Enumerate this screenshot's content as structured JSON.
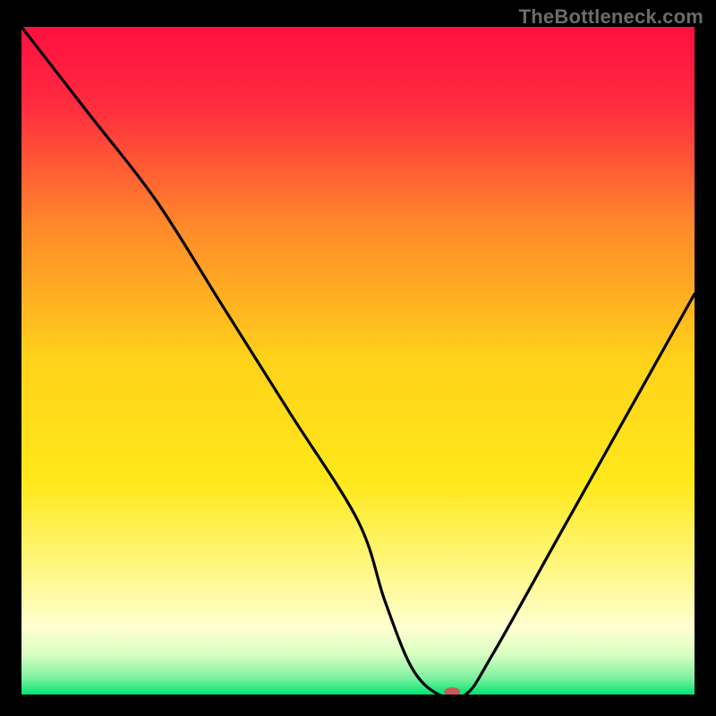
{
  "watermark": "TheBottleneck.com",
  "chart_data": {
    "type": "line",
    "title": "",
    "xlabel": "",
    "ylabel": "",
    "xlim": [
      0,
      100
    ],
    "ylim": [
      0,
      100
    ],
    "x": [
      0,
      10,
      20,
      30,
      40,
      50,
      54,
      58,
      62,
      66,
      70,
      80,
      90,
      100
    ],
    "values": [
      100,
      87,
      74,
      58,
      42,
      26,
      14,
      4,
      0,
      0,
      6,
      24,
      42,
      60
    ],
    "optimal_zone": {
      "x_start": 60,
      "x_end": 68,
      "value": 0
    },
    "background": {
      "type": "vertical_gradient_with_green_base",
      "stops": [
        {
          "pos": 0.0,
          "color": "#ff0f3f"
        },
        {
          "pos": 0.12,
          "color": "#ff2c3f"
        },
        {
          "pos": 0.3,
          "color": "#ff8a2a"
        },
        {
          "pos": 0.5,
          "color": "#ffd21a"
        },
        {
          "pos": 0.68,
          "color": "#ffe81a"
        },
        {
          "pos": 0.82,
          "color": "#fff88a"
        },
        {
          "pos": 0.9,
          "color": "#ffffd2"
        },
        {
          "pos": 0.94,
          "color": "#d9ffc2"
        },
        {
          "pos": 0.975,
          "color": "#7ef0a0"
        },
        {
          "pos": 1.0,
          "color": "#00e472"
        }
      ]
    },
    "marker": {
      "x": 64,
      "y": 0,
      "color": "#c85a5a",
      "rx": 9,
      "ry": 5
    }
  }
}
